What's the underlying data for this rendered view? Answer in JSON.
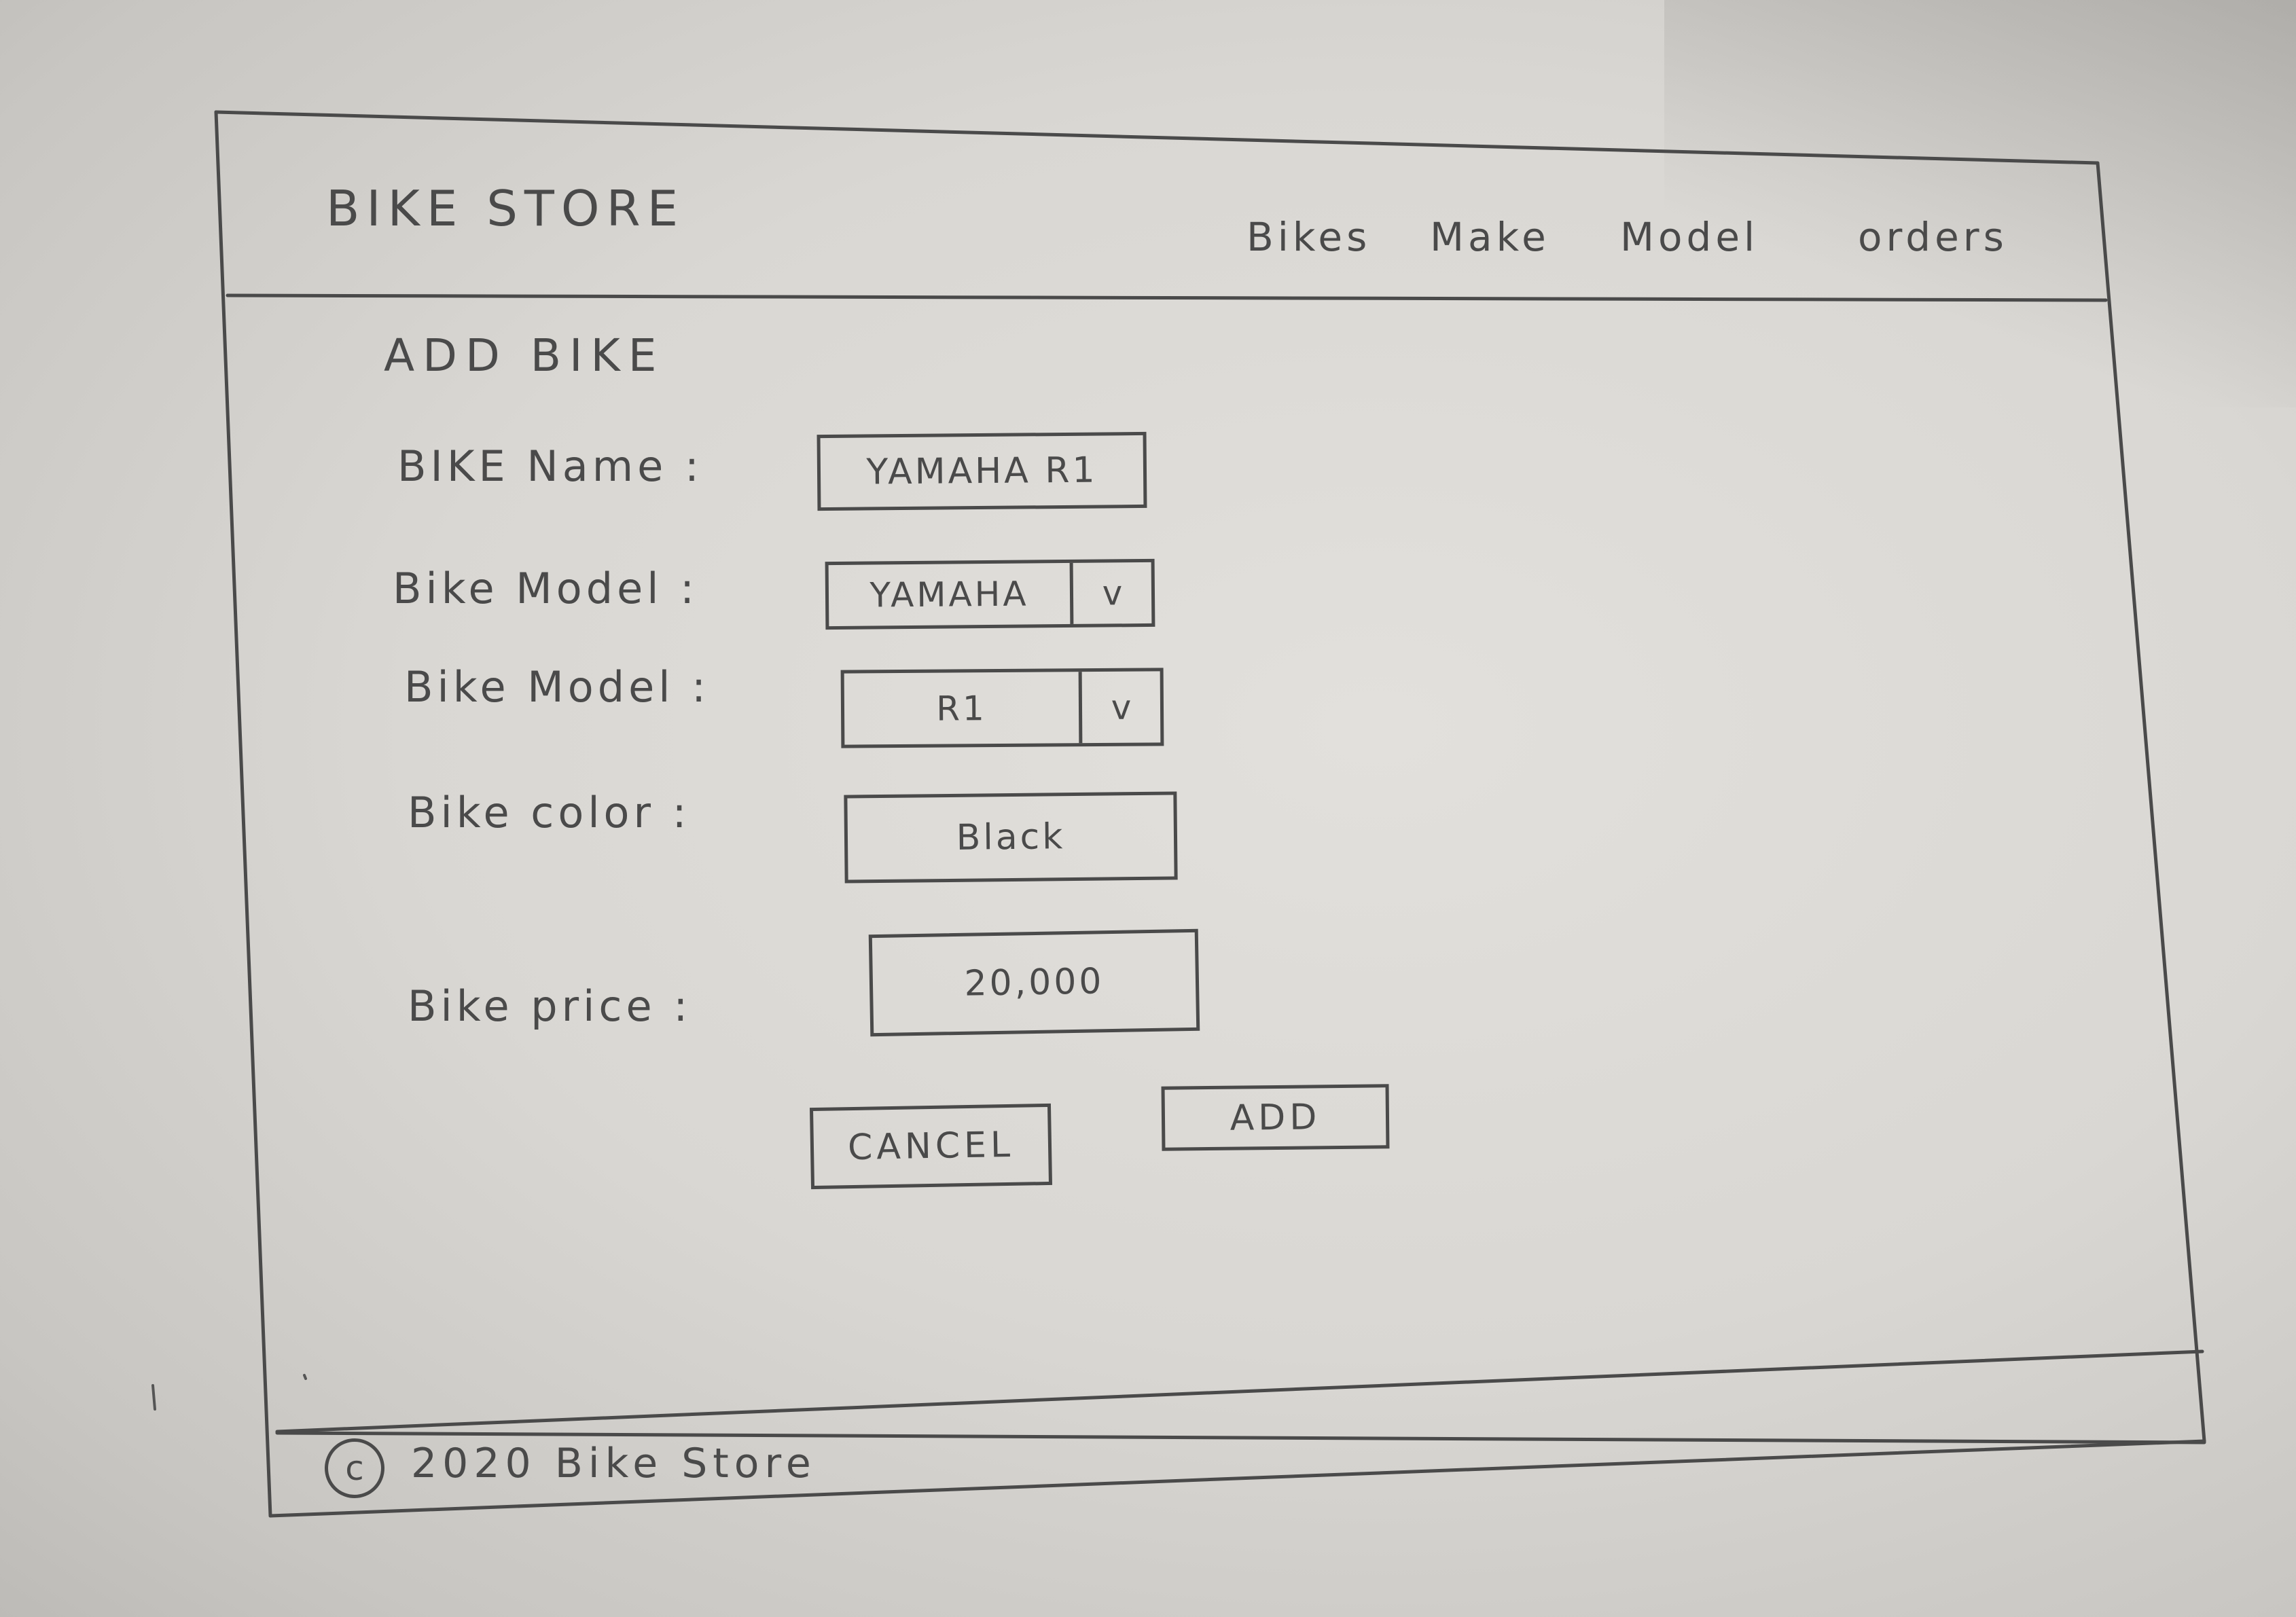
{
  "header": {
    "brand": "BIKE STORE",
    "nav": [
      "Bikes",
      "Make",
      "Model",
      "orders"
    ]
  },
  "form": {
    "title": "ADD BIKE",
    "fields": {
      "name": {
        "label": "BIKE Name :",
        "value": "YAMAHA R1"
      },
      "make": {
        "label": "Bike Model :",
        "value": "YAMAHA",
        "arrow": "v"
      },
      "model": {
        "label": "Bike Model :",
        "value": "R1",
        "arrow": "v"
      },
      "color": {
        "label": "Bike color :",
        "value": "Black"
      },
      "price": {
        "label": "Bike price :",
        "value": "20,000"
      }
    },
    "buttons": {
      "cancel": "CANCEL",
      "add": "ADD"
    }
  },
  "footer": {
    "copyright_symbol": "c",
    "text": "2020 Bike Store"
  },
  "colors": {
    "paper": "#dcdad6",
    "ink": "#4a4a4a"
  }
}
